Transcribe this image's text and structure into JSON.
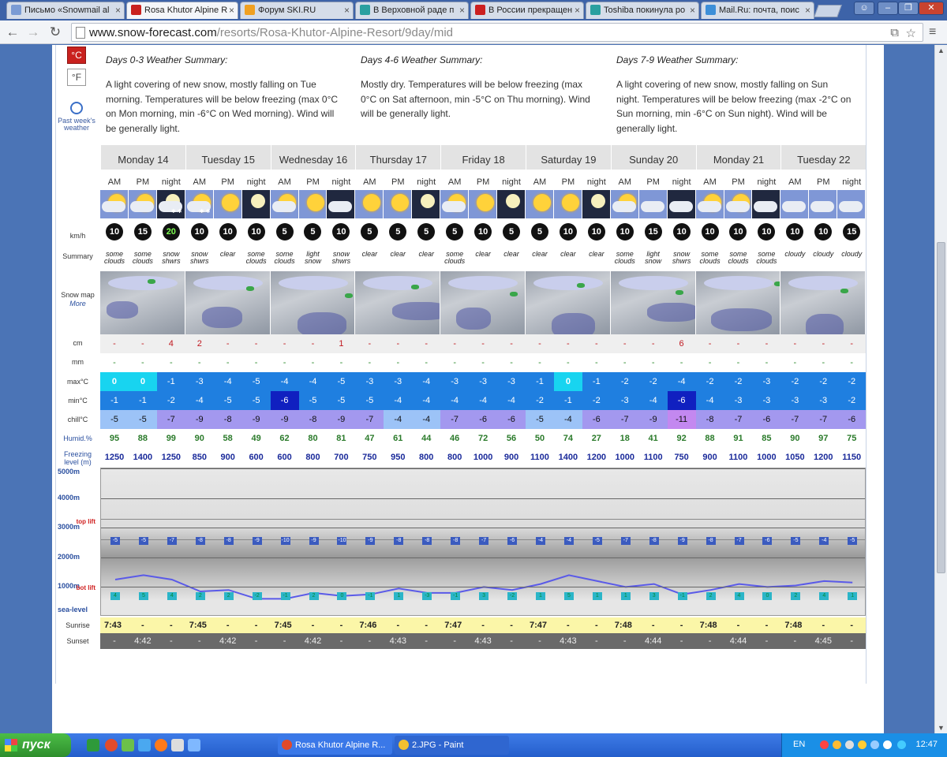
{
  "browser": {
    "tabs": [
      {
        "label": "Письмо «Snowmail al",
        "color": "#7a9bd4"
      },
      {
        "label": "Rosa Khutor Alpine R",
        "color": "#c9211e"
      },
      {
        "label": "Форум SKI.RU",
        "color": "#f0a020"
      },
      {
        "label": "В Верховной раде п",
        "color": "#2aa0a0"
      },
      {
        "label": "В России прекращен",
        "color": "#cc2020"
      },
      {
        "label": "Toshiba покинула ро",
        "color": "#2aa0a0"
      },
      {
        "label": "Mail.Ru: почта, поис",
        "color": "#3d8fd8"
      }
    ],
    "url_host": "www.snow-forecast.com",
    "url_path": "/resorts/Rosa-Khutor-Alpine-Resort/9day/mid"
  },
  "units": {
    "celsius": "°C",
    "fahrenheit": "°F"
  },
  "past_week": "Past week's weather",
  "summaries": [
    {
      "title": "Days 0-3 Weather Summary:",
      "text": "A light covering of new snow, mostly falling on Tue morning. Temperatures will be below freezing (max 0°C on Mon morning, min -6°C on Wed morning). Wind will be generally light."
    },
    {
      "title": "Days 4-6 Weather Summary:",
      "text": "Mostly dry. Temperatures will be below freezing (max 0°C on Sat afternoon, min -5°C on Thu morning). Wind will be generally light."
    },
    {
      "title": "Days 7-9 Weather Summary:",
      "text": "A light covering of new snow, mostly falling on Sun night. Temperatures will be below freezing (max -2°C on Sun morning, min -6°C on Sun night). Wind will be generally light."
    }
  ],
  "row_labels": {
    "wind": "km/h",
    "summary": "Summary",
    "snowmap": "Snow map",
    "more": "More",
    "snow": "cm",
    "rain": "mm",
    "max": "max°C",
    "min": "min°C",
    "chill": "chill°C",
    "humid": "Humid.%",
    "freezing": "Freezing level (m)",
    "sunrise": "Sunrise",
    "sunset": "Sunset"
  },
  "periods": [
    "AM",
    "PM",
    "night"
  ],
  "days": [
    "Monday 14",
    "Tuesday 15",
    "Wednesday 16",
    "Thursday 17",
    "Friday 18",
    "Saturday 19",
    "Sunday 20",
    "Monday 21",
    "Tuesday 22"
  ],
  "weather": [
    "pc",
    "pc",
    "sn",
    "pcs",
    "sun",
    "mn",
    "pc",
    "sun",
    "mc",
    "sun",
    "sun",
    "mn",
    "pc",
    "sun",
    "mn",
    "sun",
    "sun",
    "mn",
    "pc",
    "cl",
    "mc",
    "pc",
    "pc",
    "mc",
    "cl",
    "cl",
    "cl"
  ],
  "wind": [
    "10",
    "15",
    "20",
    "10",
    "10",
    "10",
    "5",
    "5",
    "10",
    "5",
    "5",
    "5",
    "5",
    "10",
    "5",
    "5",
    "10",
    "10",
    "10",
    "15",
    "10",
    "10",
    "10",
    "10",
    "10",
    "10",
    "15"
  ],
  "summary": [
    "some clouds",
    "some clouds",
    "snow shwrs",
    "snow shwrs",
    "clear",
    "some clouds",
    "some clouds",
    "light snow",
    "snow shwrs",
    "clear",
    "clear",
    "clear",
    "some clouds",
    "clear",
    "clear",
    "clear",
    "clear",
    "clear",
    "some clouds",
    "light snow",
    "snow shwrs",
    "some clouds",
    "some clouds",
    "some clouds",
    "cloudy",
    "cloudy",
    "cloudy"
  ],
  "snow": [
    "-",
    "-",
    "4",
    "2",
    "-",
    "-",
    "-",
    "-",
    "1",
    "-",
    "-",
    "-",
    "-",
    "-",
    "-",
    "-",
    "-",
    "-",
    "-",
    "-",
    "6",
    "-",
    "-",
    "-",
    "-",
    "-",
    "-"
  ],
  "rain": [
    "-",
    "-",
    "-",
    "-",
    "-",
    "-",
    "-",
    "-",
    "-",
    "-",
    "-",
    "-",
    "-",
    "-",
    "-",
    "-",
    "-",
    "-",
    "-",
    "-",
    "-",
    "-",
    "-",
    "-",
    "-",
    "-",
    "-"
  ],
  "max": [
    "0",
    "0",
    "-1",
    "-3",
    "-4",
    "-5",
    "-4",
    "-4",
    "-5",
    "-3",
    "-3",
    "-4",
    "-3",
    "-3",
    "-3",
    "-1",
    "0",
    "-1",
    "-2",
    "-2",
    "-4",
    "-2",
    "-2",
    "-3",
    "-2",
    "-2",
    "-2"
  ],
  "min": [
    "-1",
    "-1",
    "-2",
    "-4",
    "-5",
    "-5",
    "-6",
    "-5",
    "-5",
    "-5",
    "-4",
    "-4",
    "-4",
    "-4",
    "-4",
    "-2",
    "-1",
    "-2",
    "-3",
    "-4",
    "-6",
    "-4",
    "-3",
    "-3",
    "-3",
    "-3",
    "-2"
  ],
  "chill": [
    "-5",
    "-5",
    "-7",
    "-9",
    "-8",
    "-9",
    "-9",
    "-8",
    "-9",
    "-7",
    "-4",
    "-4",
    "-7",
    "-6",
    "-6",
    "-5",
    "-4",
    "-6",
    "-7",
    "-9",
    "-11",
    "-8",
    "-7",
    "-6",
    "-7",
    "-7",
    "-6"
  ],
  "humid": [
    "95",
    "88",
    "99",
    "90",
    "58",
    "49",
    "62",
    "80",
    "81",
    "47",
    "61",
    "44",
    "46",
    "72",
    "56",
    "50",
    "74",
    "27",
    "18",
    "41",
    "92",
    "88",
    "91",
    "85",
    "90",
    "97",
    "75"
  ],
  "freezing": [
    "1250",
    "1400",
    "1250",
    "850",
    "900",
    "600",
    "600",
    "800",
    "700",
    "750",
    "950",
    "800",
    "800",
    "1000",
    "900",
    "1100",
    "1400",
    "1200",
    "1000",
    "1100",
    "750",
    "900",
    "1100",
    "1000",
    "1050",
    "1200",
    "1150"
  ],
  "chart": {
    "levels": [
      "5000m",
      "4000m",
      "3000m",
      "2000m",
      "1000m",
      "sea-level"
    ],
    "top_lift": "top lift",
    "bot_lift": "bot lift",
    "top_temps": [
      "-5",
      "-5",
      "-7",
      "-8",
      "-8",
      "-9",
      "-10",
      "-9",
      "-10",
      "-9",
      "-8",
      "-8",
      "-8",
      "-7",
      "-6",
      "-4",
      "-4",
      "-5",
      "-7",
      "-8",
      "-9",
      "-8",
      "-7",
      "-6",
      "-5",
      "-4",
      "-5"
    ],
    "bot_temps": [
      "4",
      "5",
      "4",
      "2",
      "2",
      "-2",
      "-1",
      "2",
      "0",
      "-1",
      "1",
      "-3",
      "-1",
      "3",
      "-2",
      "1",
      "5",
      "1",
      "1",
      "3",
      "-1",
      "2",
      "4",
      "0",
      "2",
      "4",
      "1"
    ]
  },
  "sunrise": [
    "7:43",
    "7:45",
    "7:45",
    "7:46",
    "7:47",
    "7:47",
    "7:48",
    "7:48",
    "7:48"
  ],
  "sunset": [
    "4:42",
    "4:42",
    "4:42",
    "4:43",
    "4:43",
    "4:43",
    "4:44",
    "4:44",
    "4:45"
  ],
  "dash": "-",
  "taskbar": {
    "start": "пуск",
    "tasks": [
      {
        "label": "Rosa Khutor Alpine R...",
        "color": "#e04a2a"
      },
      {
        "label": "2.JPG - Paint",
        "color": "#f2c030"
      }
    ],
    "lang": "EN",
    "time": "12:47"
  }
}
